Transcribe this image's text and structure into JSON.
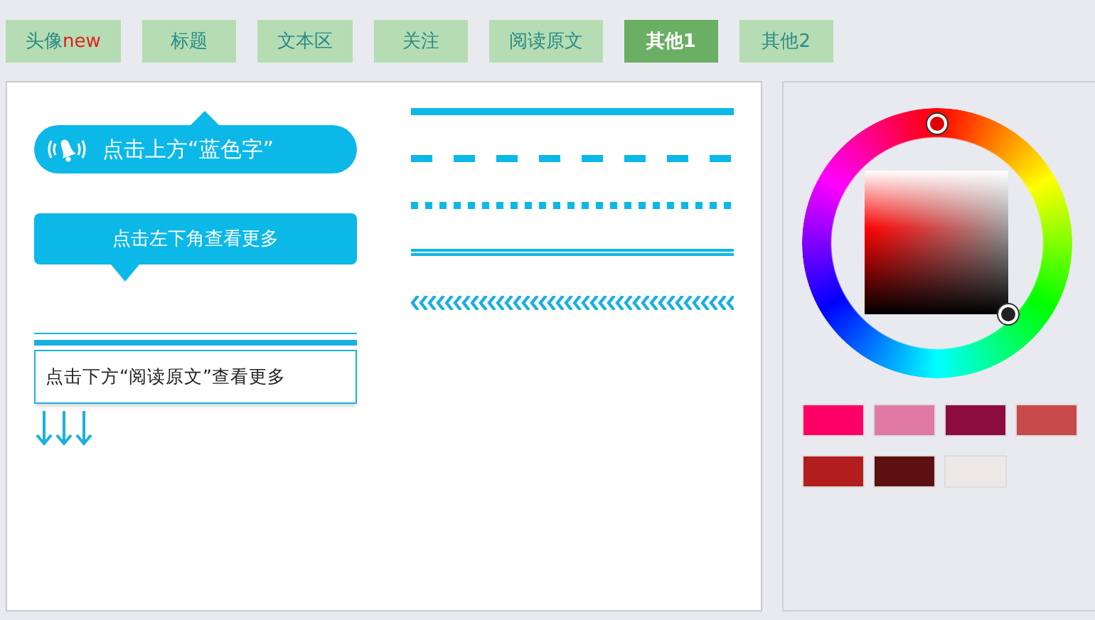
{
  "tabs": [
    {
      "label": "头像",
      "badge": "new",
      "selected": false
    },
    {
      "label": "标题",
      "selected": false
    },
    {
      "label": "文本区",
      "selected": false
    },
    {
      "label": "关注",
      "selected": false
    },
    {
      "label": "阅读原文",
      "selected": false
    },
    {
      "label": "其他1",
      "selected": true
    },
    {
      "label": "其他2",
      "selected": false
    }
  ],
  "bubbles": [
    {
      "kind": "bell",
      "text": "点击上方“蓝色字”"
    },
    {
      "kind": "tail-down",
      "text": "点击左下角查看更多"
    },
    {
      "kind": "boxed-arrows",
      "text": "点击下方“阅读原文”查看更多"
    }
  ],
  "dividers": [
    {
      "kind": "solid"
    },
    {
      "kind": "dashed"
    },
    {
      "kind": "dotted"
    },
    {
      "kind": "double"
    },
    {
      "kind": "chevron"
    }
  ],
  "swatches": [
    {
      "color": "#ff0066"
    },
    {
      "color": "#e07aa4"
    },
    {
      "color": "#8c0c3e"
    },
    {
      "color": "#c94a4a"
    },
    {
      "color": "#b21e1e"
    },
    {
      "color": "#5c1010"
    },
    {
      "color": "#ece8e8"
    }
  ]
}
